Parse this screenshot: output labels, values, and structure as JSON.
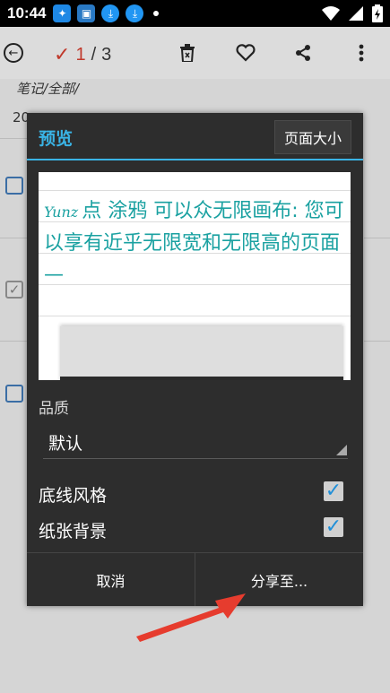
{
  "status_bar": {
    "time": "10:44"
  },
  "toolbar": {
    "selected": "1",
    "separator": "/",
    "total": "3"
  },
  "breadcrumb": "笔记/全部/",
  "date_stub": "20",
  "dialog": {
    "title": "预览",
    "page_size_label": "页面大小",
    "preview_text": "点 涂鸦 可以众无限画布: 您可以享有近乎无限宽和无限高的页面 —",
    "preview_signature": "Yunz",
    "quality_label": "品质",
    "quality_value": "默认",
    "options": [
      {
        "label": "底线风格",
        "checked": true
      },
      {
        "label": "纸张背景",
        "checked": true
      }
    ],
    "cancel_label": "取消",
    "share_label": "分享至..."
  },
  "colors": {
    "accent": "#3ab4e6",
    "teal_ink": "#1aa1a1",
    "arrow": "#e63c2e",
    "dialog_bg": "#2d2d2d"
  }
}
